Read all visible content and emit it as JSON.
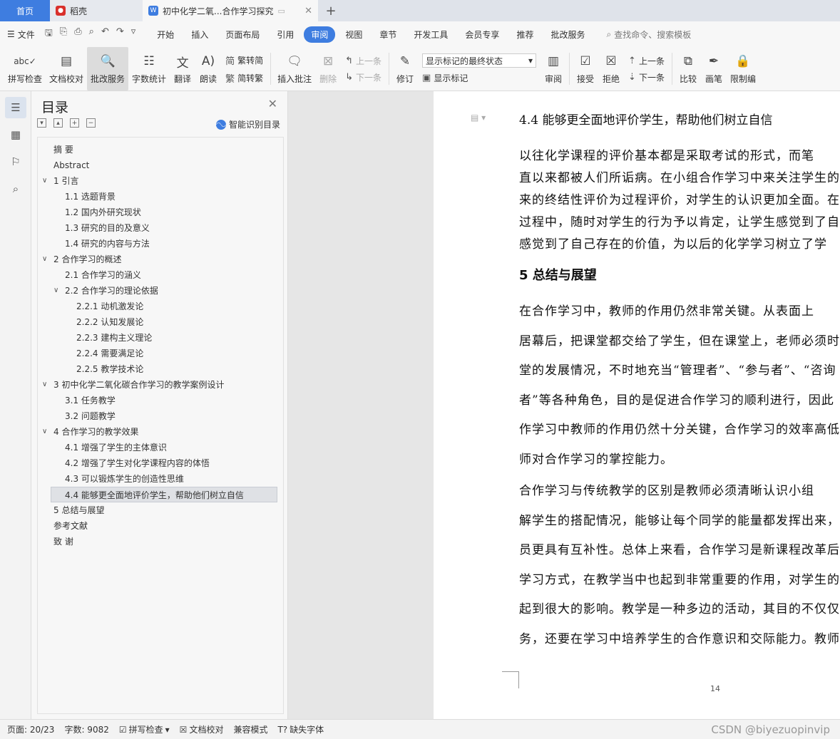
{
  "tabs": {
    "home": "首页",
    "shell": "稻壳",
    "document": "初中化学二氧...合作学习探究",
    "add": "+"
  },
  "menubar": {
    "file": "文件",
    "items": [
      "开始",
      "插入",
      "页面布局",
      "引用",
      "审阅",
      "视图",
      "章节",
      "开发工具",
      "会员专享",
      "推荐",
      "批改服务"
    ],
    "active": "审阅",
    "search": "查找命令、搜索模板"
  },
  "ribbon": {
    "spell_check": "拼写检查",
    "doc_proof": "文档校对",
    "correction_service": "批改服务",
    "word_count": "字数统计",
    "translate": "翻译",
    "read_aloud": "朗读",
    "trad_to_simp": "繁转简",
    "simp_to_trad": "简转繁",
    "insert_comment": "插入批注",
    "delete": "删除",
    "prev_comment": "上一条",
    "next_comment": "下一条",
    "track_changes": "修订",
    "markup_select": "显示标记的最终状态",
    "show_markup": "显示标记",
    "review": "审阅",
    "accept": "接受",
    "reject": "拒绝",
    "prev_change": "上一条",
    "next_change": "下一条",
    "compare": "比较",
    "pen": "画笔",
    "restrict": "限制编"
  },
  "toc": {
    "title": "目录",
    "smart_label": "智能识别目录",
    "items": [
      {
        "text": "摘    要",
        "level": 1,
        "caret": ""
      },
      {
        "text": "Abstract",
        "level": 1,
        "caret": ""
      },
      {
        "text": "1  引言",
        "level": 1,
        "caret": "v"
      },
      {
        "text": "1.1  选题背景",
        "level": 2,
        "caret": ""
      },
      {
        "text": "1.2  国内外研究现状",
        "level": 2,
        "caret": ""
      },
      {
        "text": "1.3  研究的目的及意义",
        "level": 2,
        "caret": ""
      },
      {
        "text": "1.4  研究的内容与方法",
        "level": 2,
        "caret": ""
      },
      {
        "text": "2  合作学习的概述",
        "level": 1,
        "caret": "v"
      },
      {
        "text": "2.1  合作学习的涵义",
        "level": 2,
        "caret": ""
      },
      {
        "text": "2.2  合作学习的理论依据",
        "level": 2,
        "caret": "v"
      },
      {
        "text": "2.2.1 动机激发论",
        "level": 3,
        "caret": ""
      },
      {
        "text": "2.2.2 认知发展论",
        "level": 3,
        "caret": ""
      },
      {
        "text": "2.2.3 建构主义理论",
        "level": 3,
        "caret": ""
      },
      {
        "text": "2.2.4 需要满足论",
        "level": 3,
        "caret": ""
      },
      {
        "text": "2.2.5 教学技术论",
        "level": 3,
        "caret": ""
      },
      {
        "text": "3  初中化学二氧化碳合作学习的教学案例设计",
        "level": 1,
        "caret": "v"
      },
      {
        "text": "3.1  任务教学",
        "level": 2,
        "caret": ""
      },
      {
        "text": "3.2  问题教学",
        "level": 2,
        "caret": ""
      },
      {
        "text": "4  合作学习的教学效果",
        "level": 1,
        "caret": "v"
      },
      {
        "text": "4.1 增强了学生的主体意识",
        "level": 2,
        "caret": ""
      },
      {
        "text": "4.2 增强了学生对化学课程内容的体悟",
        "level": 2,
        "caret": ""
      },
      {
        "text": "4.3 可以锻炼学生的创造性思维",
        "level": 2,
        "caret": ""
      },
      {
        "text": "4.4 能够更全面地评价学生，帮助他们树立自信",
        "level": 2,
        "caret": "",
        "selected": true
      },
      {
        "text": "5  总结与展望",
        "level": 1,
        "caret": ""
      },
      {
        "text": "参考文献",
        "level": 1,
        "caret": ""
      },
      {
        "text": "致    谢",
        "level": 1,
        "caret": ""
      }
    ]
  },
  "document": {
    "heading_44": "4.4 能够更全面地评价学生，帮助他们树立自信",
    "para1": [
      "    以往化学课程的评价基本都是采取考试的形式，而笔",
      "直以来都被人们所诟病。在小组合作学习中来关注学生的",
      "来的终结性评价为过程评价，对学生的认识更加全面。在",
      "过程中，随时对学生的行为予以肯定，让学生感觉到了自",
      "感觉到了自己存在的价值，为以后的化学学习树立了学"
    ],
    "heading_5": "5  总结与展望",
    "para2": [
      "    在合作学习中，教师的作用仍然非常关键。从表面上",
      "居幕后，把课堂都交给了学生，但在课堂上，老师必须时",
      "堂的发展情况，不时地充当“管理者”、“参与者”、“咨询",
      "者”等各种角色，目的是促进合作学习的顺利进行，因此",
      "作学习中教师的作用仍然十分关键，合作学习的效率高低",
      "师对合作学习的掌控能力。"
    ],
    "para3": [
      "     合作学习与传统教学的区别是教师必须清晰认识小组",
      "解学生的搭配情况，能够让每个同学的能量都发挥出来，",
      "员更具有互补性。总体上来看，合作学习是新课程改革后",
      "学习方式，在教学当中也起到非常重要的作用，对学生的",
      "起到很大的影响。教学是一种多边的活动，其目的不仅仅",
      "务，还要在学习中培养学生的合作意识和交际能力。教师"
    ],
    "page_number": "14"
  },
  "statusbar": {
    "page": "页面: 20/23",
    "words": "字数: 9082",
    "spell_check": "拼写检查",
    "doc_proof": "文档校对",
    "compat": "兼容模式",
    "missing_fonts": "缺失字体",
    "watermark": "CSDN @biyezuopinvip"
  },
  "colors": {
    "accent": "#3e7de0",
    "shell_red": "#d9302b"
  }
}
